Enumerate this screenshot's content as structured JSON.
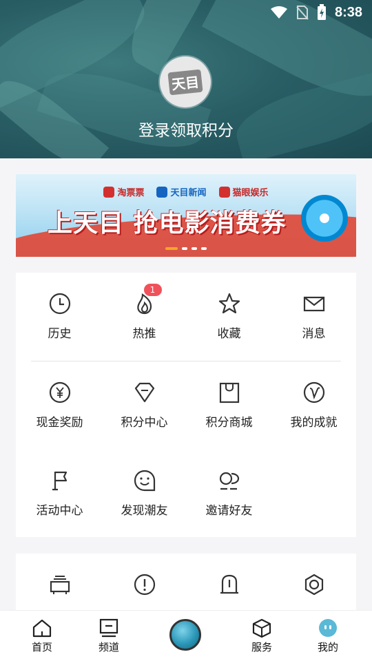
{
  "status_bar": {
    "time": "8:38"
  },
  "header": {
    "avatar_text": "天目",
    "login_text": "登录领取积分"
  },
  "banner": {
    "partners": [
      "淘票票",
      "天目新闻",
      "猫眼娱乐"
    ],
    "title": "上天目 抢电影消费券",
    "page_count": 4,
    "active_index": 0
  },
  "grid": {
    "items": [
      {
        "label": "历史",
        "icon": "clock-icon"
      },
      {
        "label": "热推",
        "icon": "flame-icon",
        "badge": "1"
      },
      {
        "label": "收藏",
        "icon": "star-icon"
      },
      {
        "label": "消息",
        "icon": "mail-icon"
      },
      {
        "label": "现金奖励",
        "icon": "yen-coin-icon"
      },
      {
        "label": "积分中心",
        "icon": "diamond-icon"
      },
      {
        "label": "积分商城",
        "icon": "shopping-bag-icon"
      },
      {
        "label": "我的成就",
        "icon": "v-badge-icon"
      },
      {
        "label": "活动中心",
        "icon": "flag-icon"
      },
      {
        "label": "发现潮友",
        "icon": "smile-chat-icon"
      },
      {
        "label": "邀请好友",
        "icon": "invite-friends-icon"
      }
    ]
  },
  "grid2": {
    "items": [
      {
        "label": "",
        "icon": "report-icon"
      },
      {
        "label": "",
        "icon": "feedback-icon"
      },
      {
        "label": "",
        "icon": "bell-icon"
      },
      {
        "label": "",
        "icon": "settings-hex-icon"
      }
    ]
  },
  "bottom_nav": {
    "items": [
      {
        "label": "首页",
        "icon": "home-icon"
      },
      {
        "label": "频道",
        "icon": "channel-icon"
      },
      {
        "label": "",
        "icon": "center-lens-icon"
      },
      {
        "label": "服务",
        "icon": "cube-icon"
      },
      {
        "label": "我的",
        "icon": "me-icon",
        "active": true
      }
    ]
  }
}
